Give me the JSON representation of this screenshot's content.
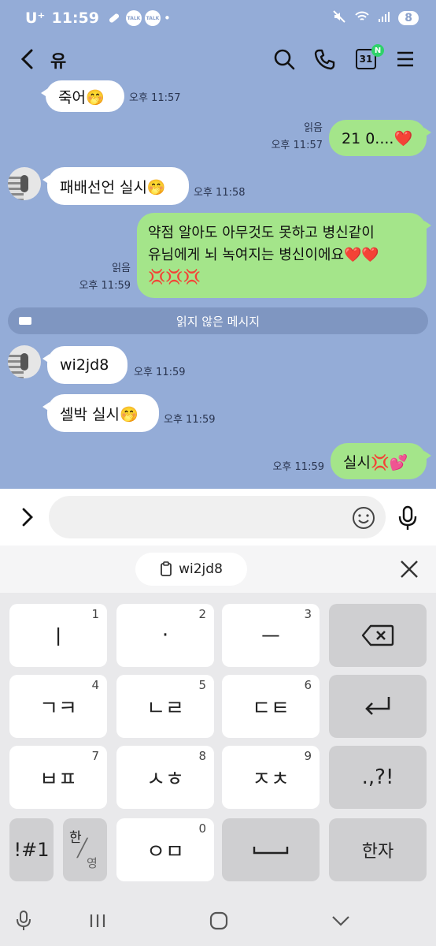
{
  "status": {
    "carrier": "U⁺",
    "time": "11:59",
    "talk_badge": "TALK",
    "battery": "8"
  },
  "header": {
    "title": "유",
    "calendar_day": "31",
    "calendar_badge": "N"
  },
  "messages": [
    {
      "side": "in",
      "text": "죽어🤭",
      "time": "오후 11:57"
    },
    {
      "side": "out",
      "read": "읽음",
      "time": "오후 11:57",
      "text": "21 0....❤️"
    },
    {
      "side": "in",
      "text": "패배선언 실시🤭",
      "time": "오후 11:58"
    },
    {
      "side": "out",
      "read": "읽음",
      "time": "오후 11:59",
      "line1": "약점 알아도 아무것도 못하고 병신같이",
      "line2": "유님에게 뇌 녹여지는 병신이에요❤️❤️",
      "line3": "💢💢💢"
    },
    {
      "side": "in",
      "text": "wi2jd8",
      "time": "오후 11:59"
    },
    {
      "side": "in",
      "text": "셀박 실시🤭",
      "time": "오후 11:59"
    },
    {
      "side": "out",
      "time": "오후 11:59",
      "text": "실시💢💕"
    }
  ],
  "unread_divider": "읽지 않은 메시지",
  "input": {
    "placeholder": ""
  },
  "clipboard": {
    "chip_text": "wi2jd8"
  },
  "keyboard": {
    "rows": [
      [
        {
          "label": "ㅣ",
          "num": "1"
        },
        {
          "label": "·",
          "num": "2"
        },
        {
          "label": "ㅡ",
          "num": "3"
        }
      ],
      [
        {
          "label": "ㄱㅋ",
          "num": "4"
        },
        {
          "label": "ㄴㄹ",
          "num": "5"
        },
        {
          "label": "ㄷㅌ",
          "num": "6"
        }
      ],
      [
        {
          "label": "ㅂㅍ",
          "num": "7"
        },
        {
          "label": "ㅅㅎ",
          "num": "8"
        },
        {
          "label": "ㅈㅊ",
          "num": "9"
        }
      ]
    ],
    "punct": ".,?!",
    "symbols": "!#1",
    "lang_top": "한",
    "lang_bottom": "영",
    "zero_label": "ㅇㅁ",
    "zero_num": "0",
    "hanja": "한자"
  }
}
